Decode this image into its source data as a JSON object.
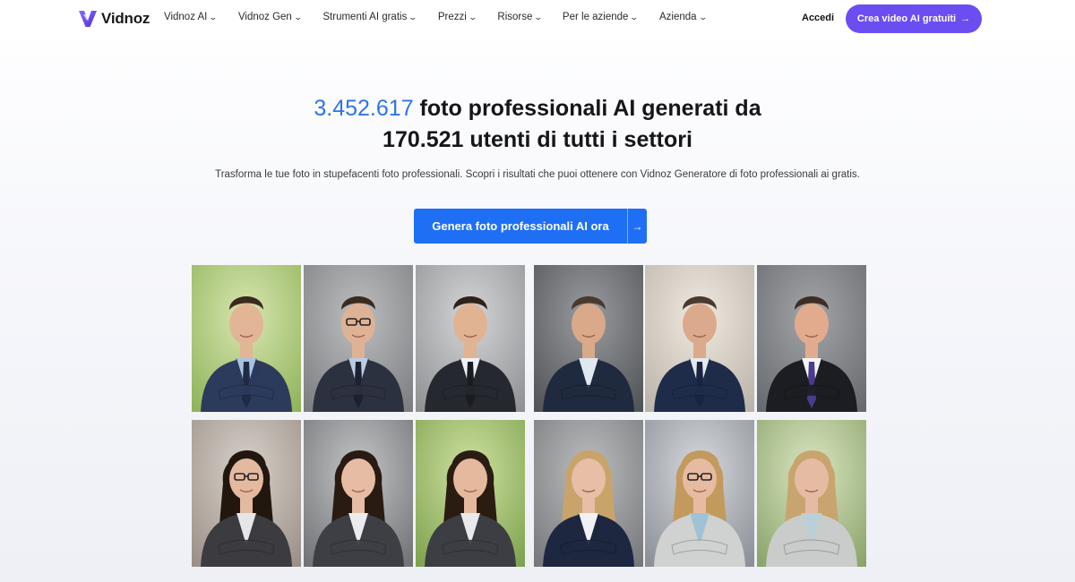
{
  "header": {
    "logo_text": "Vidnoz",
    "nav": [
      {
        "label": "Vidnoz AI"
      },
      {
        "label": "Vidnoz Gen"
      },
      {
        "label": "Strumenti AI gratis"
      },
      {
        "label": "Prezzi"
      },
      {
        "label": "Risorse"
      },
      {
        "label": "Per le aziende"
      },
      {
        "label": "Azienda"
      }
    ],
    "login_label": "Accedi",
    "cta_label": "Crea video AI gratuiti",
    "cta_arrow": "→"
  },
  "hero": {
    "count_photos": "3.452.617",
    "title_line1_rest": " foto professionali AI generati da",
    "title_line2": "170.521 utenti di tutti i settori",
    "subtitle": "Trasforma le tue foto in stupefacenti foto professionali. Scopri i risultati che puoi ottenere con Vidnoz Generatore di foto professionali ai gratis.",
    "button_label": "Genera foto professionali AI ora",
    "button_arrow": "→"
  },
  "colors": {
    "accent_purple": "#6b4df2",
    "accent_blue": "#1f6ff5",
    "number_blue": "#2f73e8"
  },
  "gallery": [
    {
      "name": "portrait-man-young-outdoor",
      "gender": "m",
      "bg": "#8fb35a",
      "bg2": "#d8e6b0",
      "suit": "#2c3a5c",
      "shirt": "#a9c2de",
      "tie": "#1f2a44",
      "hair": "#3a2a1c",
      "skin": "#e2b597"
    },
    {
      "name": "portrait-man-glasses-grey",
      "gender": "m",
      "bg": "#7b7d80",
      "bg2": "#bdbec0",
      "suit": "#2c3140",
      "shirt": "#b8cce4",
      "tie": "#1c2030",
      "hair": "#3b2b1f",
      "skin": "#deb295",
      "glasses": true
    },
    {
      "name": "portrait-man-young-office",
      "gender": "m",
      "bg": "#8e9093",
      "bg2": "#d4d5d7",
      "suit": "#25282f",
      "shirt": "#eef1f5",
      "tie": "#1a1c22",
      "hair": "#2e2218",
      "skin": "#e0b392"
    },
    {
      "name": "portrait-man-middle-aged-dark",
      "gender": "m",
      "bg": "#4f5256",
      "bg2": "#9a9c9f",
      "suit": "#1f2a3e",
      "shirt": "#dfe7ef",
      "tie": "",
      "hair": "#4a3a2e",
      "skin": "#d9a98a"
    },
    {
      "name": "portrait-man-middle-aged-bright",
      "gender": "m",
      "bg": "#b9b3aa",
      "bg2": "#efe9df",
      "suit": "#1e2c49",
      "shirt": "#e4e9f0",
      "tie": "#1a2440",
      "hair": "#4a3a2e",
      "skin": "#dba98b"
    },
    {
      "name": "portrait-man-purple-tie",
      "gender": "m",
      "bg": "#66696d",
      "bg2": "#a3a5a8",
      "suit": "#1c1d22",
      "shirt": "#f3f3f5",
      "tie": "#4a3b8c",
      "hair": "#3e2d22",
      "skin": "#e3ab8d"
    },
    {
      "name": "portrait-woman-glasses",
      "gender": "f",
      "bg": "#9a8f86",
      "bg2": "#d8d2cb",
      "suit": "#3b3b40",
      "shirt": "#e6e6e8",
      "tie": "",
      "hair": "#22170f",
      "skin": "#e3b9a0",
      "glasses": true
    },
    {
      "name": "portrait-woman-grey-bg",
      "gender": "f",
      "bg": "#6f7174",
      "bg2": "#c4c5c7",
      "suit": "#3e3f45",
      "shirt": "#ececee",
      "tie": "",
      "hair": "#2a1b12",
      "skin": "#e6bca4"
    },
    {
      "name": "portrait-woman-outdoor",
      "gender": "f",
      "bg": "#7da24e",
      "bg2": "#cfe0a0",
      "suit": "#3d3e44",
      "shirt": "#e9e9eb",
      "tie": "",
      "hair": "#2b1c12",
      "skin": "#e4b99e"
    },
    {
      "name": "portrait-woman-blonde-navy",
      "gender": "f",
      "bg": "#75777a",
      "bg2": "#bcbdbf",
      "suit": "#1e2740",
      "shirt": "#f0f1f4",
      "tie": "",
      "hair": "#c9a46a",
      "skin": "#e7bea6"
    },
    {
      "name": "portrait-woman-blonde-light",
      "gender": "f",
      "bg": "#8a8f96",
      "bg2": "#d6d9dd",
      "suit": "#cfd2d0",
      "shirt": "#9fc3d4",
      "tie": "",
      "hair": "#c39a5e",
      "skin": "#e6bba1",
      "glasses": true
    },
    {
      "name": "portrait-woman-blonde-outdoor",
      "gender": "f",
      "bg": "#8aa36a",
      "bg2": "#dbe6c2",
      "suit": "#c9ccca",
      "shirt": "#b9d0d8",
      "tie": "",
      "hair": "#c8a56f",
      "skin": "#e5bca3"
    }
  ]
}
